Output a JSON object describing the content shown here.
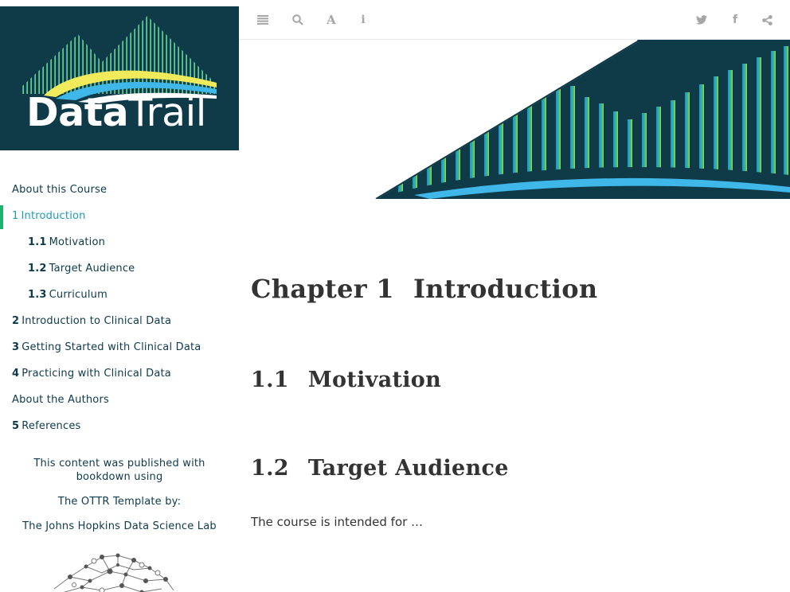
{
  "sidebar": {
    "logo": {
      "text_bold": "Data",
      "text_light": "Trail"
    },
    "toc": [
      {
        "num": "",
        "label": "About this Course"
      },
      {
        "num": "1",
        "label": "Introduction"
      },
      {
        "num": "1.1",
        "label": "Motivation"
      },
      {
        "num": "1.2",
        "label": "Target Audience"
      },
      {
        "num": "1.3",
        "label": "Curriculum"
      },
      {
        "num": "2",
        "label": "Introduction to Clinical Data"
      },
      {
        "num": "3",
        "label": "Getting Started with Clinical Data"
      },
      {
        "num": "4",
        "label": "Practicing with Clinical Data"
      },
      {
        "num": "",
        "label": "About the Authors"
      },
      {
        "num": "5",
        "label": "References"
      }
    ],
    "credits": {
      "published": "This content was published with bookdown using",
      "template": "The OTTR Template by:",
      "lab": "The Johns Hopkins Data Science Lab"
    }
  },
  "toolbar": {
    "left_icons": [
      "list-icon",
      "search-icon",
      "font-icon",
      "info-icon"
    ],
    "right_icons": [
      "twitter-icon",
      "facebook-icon",
      "share-icon"
    ],
    "icon_color": "#a6a6a6"
  },
  "content": {
    "chapter": {
      "num": "Chapter 1",
      "title": "Introduction"
    },
    "sections": [
      {
        "num": "1.1",
        "title": "Motivation"
      },
      {
        "num": "1.2",
        "title": "Target Audience"
      }
    ],
    "paragraph": "The course is intended for …"
  },
  "colors": {
    "brand_dark": "#0f3a48",
    "active_link": "#1f9bb8",
    "active_bar": "#1cb36c",
    "nav_text": "#0e3a4c"
  }
}
